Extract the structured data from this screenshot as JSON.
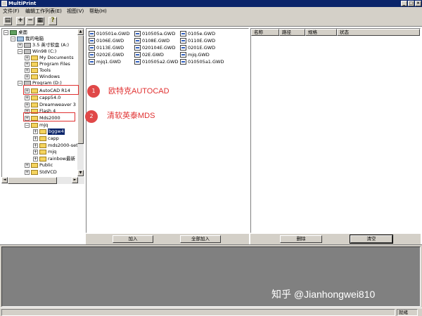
{
  "window": {
    "title": "MultiPrint",
    "minimize_glyph": "_",
    "maximize_glyph": "□",
    "close_glyph": "×"
  },
  "menubar": {
    "items": [
      {
        "label": "文件(F)"
      },
      {
        "label": "编辑工作列表(E)"
      },
      {
        "label": "视图(V)"
      },
      {
        "label": "帮助(H)"
      }
    ]
  },
  "toolbar": {
    "buttons": [
      {
        "name": "print-icon",
        "glyph": "▤"
      },
      {
        "name": "plus-icon",
        "glyph": "+"
      },
      {
        "name": "minus-icon",
        "glyph": "−"
      },
      {
        "name": "list-icon",
        "glyph": "▦"
      },
      {
        "name": "help-icon",
        "glyph": "?"
      }
    ]
  },
  "tree": {
    "nodes": [
      {
        "label": "桌面",
        "exp": "−",
        "icon": "desk"
      },
      {
        "label": "我的电脑",
        "exp": "−",
        "icon": "comp"
      },
      {
        "label": "3.5 英寸软盘 (A:)",
        "exp": "+",
        "icon": "drive"
      },
      {
        "label": "Win98 (C:)",
        "exp": "−",
        "icon": "drive"
      },
      {
        "label": "My Documents",
        "exp": "+",
        "icon": "folder"
      },
      {
        "label": "Program Files",
        "exp": "+",
        "icon": "folder"
      },
      {
        "label": "Tools",
        "exp": "+",
        "icon": "folder"
      },
      {
        "label": "Windows",
        "exp": "+",
        "icon": "folder"
      },
      {
        "label": "Program (D:)",
        "exp": "−",
        "icon": "drive"
      },
      {
        "label": "AutoCAD R14",
        "exp": "+",
        "icon": "folder"
      },
      {
        "label": "capp54.0",
        "exp": "+",
        "icon": "folder"
      },
      {
        "label": "Dreamweaver 3",
        "exp": "+",
        "icon": "folder"
      },
      {
        "label": "Flash 4",
        "exp": "+",
        "icon": "folder"
      },
      {
        "label": "Mds2000",
        "exp": "+",
        "icon": "folder"
      },
      {
        "label": "mjq",
        "exp": "−",
        "icon": "folder"
      },
      {
        "label": "bggw4",
        "exp": "+",
        "icon": "folder",
        "selected": true
      },
      {
        "label": "capp",
        "exp": "+",
        "icon": "folder"
      },
      {
        "label": "mds2000-set",
        "exp": "+",
        "icon": "folder"
      },
      {
        "label": "mjq",
        "exp": "+",
        "icon": "folder"
      },
      {
        "label": "rainbow最新",
        "exp": "+",
        "icon": "folder"
      },
      {
        "label": "Public",
        "exp": "+",
        "icon": "folder"
      },
      {
        "label": "StdVCD",
        "exp": "+",
        "icon": "folder"
      }
    ]
  },
  "files": {
    "items": [
      "010501e.GWD",
      "010505a.GWD",
      "0105e.GWD",
      "0106E.GWD",
      "0108E.GWD",
      "0110E.GWD",
      "0113E.GWD",
      "020104E.GWD",
      "0201E.GWD",
      "0202E.GWD",
      "02E.GWD",
      "mjq.GWD",
      "mjq1.GWD",
      "010505a2.GWD",
      "010505a1.GWD"
    ]
  },
  "list": {
    "columns": [
      "名称",
      "路径",
      "规格",
      "状态"
    ]
  },
  "buttons": {
    "add": "加入",
    "add_all": "全部加入",
    "delete": "删除",
    "clear": "清空"
  },
  "scroll": {
    "up": "▲",
    "down": "▼",
    "left": "◄",
    "right": "►"
  },
  "status": {
    "mode": "就绪"
  },
  "annotations": [
    {
      "num": "1",
      "text": "欧特克AUTOCAD"
    },
    {
      "num": "2",
      "text": "清软英泰MDS"
    }
  ],
  "watermark": "知乎 @Jianhongwei810"
}
